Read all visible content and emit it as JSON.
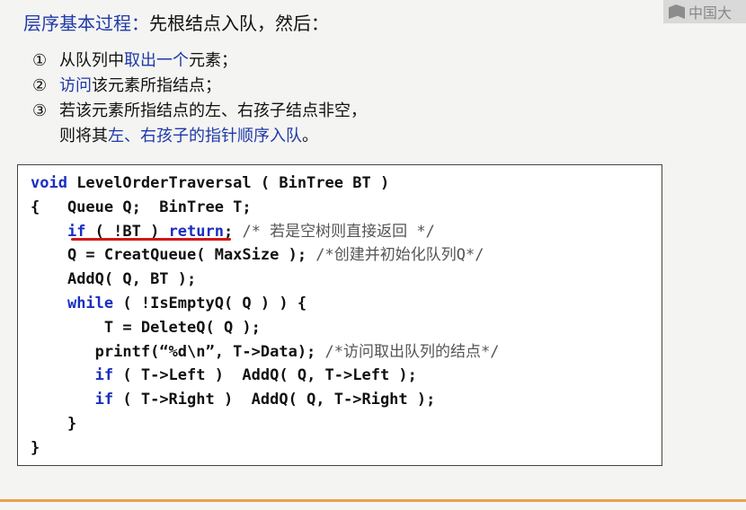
{
  "title": {
    "accent": "层序基本过程：",
    "rest": "先根结点入队，然后："
  },
  "watermark": {
    "text": "中国大"
  },
  "steps": [
    {
      "num": "①",
      "pre": "从队列中",
      "hl": "取出一个",
      "post": "元素；"
    },
    {
      "num": "②",
      "pre": "",
      "hl": "访问",
      "post": "该元素所指结点；"
    },
    {
      "num": "③",
      "pre": "若该元素所指结点的左、右孩子结点非空，",
      "hl": "",
      "post": ""
    },
    {
      "num": "",
      "pre": "则将其",
      "hl": "左、右孩子的指针顺序入队",
      "post": "。"
    }
  ],
  "code": {
    "l1_kw": "void",
    "l1_rest": " LevelOrderTraversal ( BinTree BT )",
    "l2": "{   Queue Q;  BinTree T;",
    "l3_kw1": "if",
    "l3_mid": " ( !BT ) ",
    "l3_kw2": "return",
    "l3_semi": ";",
    "l3_cm": " /* 若是空树则直接返回 */",
    "l4": "Q = CreatQueue( MaxSize );",
    "l4_cm": " /*创建并初始化队列Q*/",
    "l5": "AddQ( Q, BT );",
    "l6_kw": "while",
    "l6_rest": " ( !IsEmptyQ( Q ) ) {",
    "l7": "T = DeleteQ( Q );",
    "l8": "printf(“%d\\n”, T->Data);",
    "l8_cm": " /*访问取出队列的结点*/",
    "l9_kw": "if",
    "l9_rest": " ( T->Left )  AddQ( Q, T->Left );",
    "l10_kw": "if",
    "l10_rest": " ( T->Right )  AddQ( Q, T->Right );",
    "l11": "}",
    "l12": "}"
  },
  "colors": {
    "accent_blue": "#1f39a8",
    "keyword_blue": "#1a2fc0",
    "underline_red": "#d01818",
    "rule_orange": "#e9a050"
  }
}
